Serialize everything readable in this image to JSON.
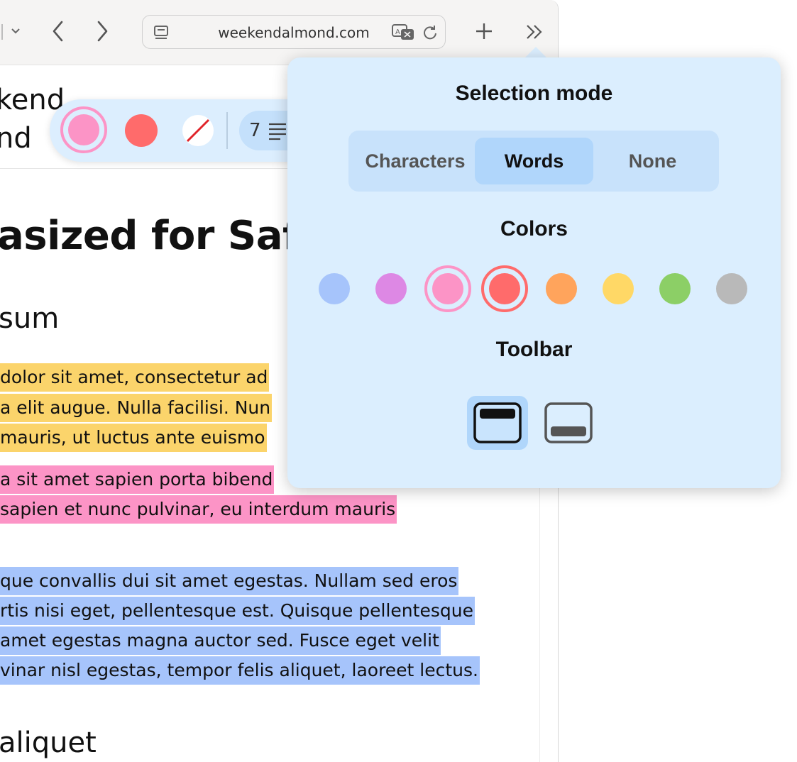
{
  "browser": {
    "url": "weekendalmond.com",
    "icons": [
      "chevron-down-icon",
      "back-icon",
      "forward-icon",
      "reader-icon",
      "translate-icon",
      "reload-icon",
      "new-tab-icon",
      "more-icon"
    ]
  },
  "page": {
    "logo_line1": "kend",
    "logo_line2": "nd",
    "heading": "asized for Safa",
    "subheading1": "sum",
    "subheading2": "aliquet",
    "highlights": [
      {
        "color": "yellow",
        "lines": [
          "dolor sit amet, consectetur ad",
          "a elit augue. Nulla facilisi. Nun",
          "mauris, ut luctus ante euismo"
        ]
      },
      {
        "color": "pink",
        "lines": [
          "a sit amet sapien porta bibend",
          "sapien et nunc pulvinar, eu interdum mauris"
        ]
      },
      {
        "color": "blue",
        "lines": [
          "que convallis dui sit amet egestas. Nullam sed eros",
          "rtis nisi eget, pellentesque est. Quisque pellentesque",
          "amet egestas magna auctor sed. Fusce eget velit",
          "vinar nisl egestas, tempor felis aliquet, laoreet lectus."
        ]
      }
    ]
  },
  "mini_toolbar": {
    "paragraph_count": "7",
    "swatches": [
      "#fc94c6",
      "#ff6b6b"
    ],
    "selected_color": "#fc94c6"
  },
  "popover": {
    "selection_title": "Selection mode",
    "modes": [
      "Characters",
      "Words",
      "None"
    ],
    "active_mode": "Words",
    "colors_title": "Colors",
    "colors": [
      "#a6c4fb",
      "#dd88e4",
      "#fc94c6",
      "#ff6b6b",
      "#ffa45c",
      "#ffd866",
      "#8ccf66",
      "#b9b9b9"
    ],
    "ringed_colors": [
      "#fc94c6",
      "#ff6b6b"
    ],
    "toolbar_title": "Toolbar",
    "toolbar_positions": [
      "top",
      "bottom"
    ],
    "active_toolbar_position": "top"
  }
}
